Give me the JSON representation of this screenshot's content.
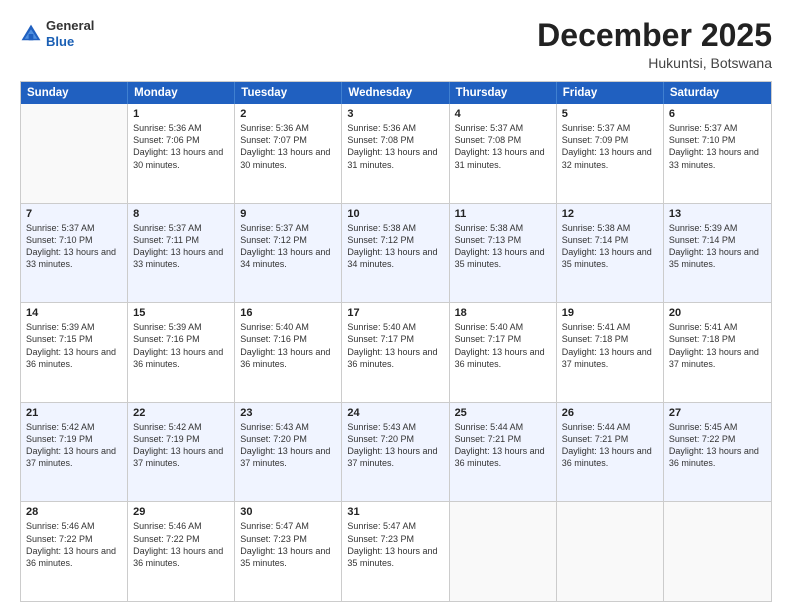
{
  "logo": {
    "general": "General",
    "blue": "Blue"
  },
  "header": {
    "month": "December 2025",
    "location": "Hukuntsi, Botswana"
  },
  "weekdays": [
    "Sunday",
    "Monday",
    "Tuesday",
    "Wednesday",
    "Thursday",
    "Friday",
    "Saturday"
  ],
  "weeks": [
    [
      {
        "day": "",
        "sunrise": "",
        "sunset": "",
        "daylight": ""
      },
      {
        "day": "1",
        "sunrise": "Sunrise: 5:36 AM",
        "sunset": "Sunset: 7:06 PM",
        "daylight": "Daylight: 13 hours and 30 minutes."
      },
      {
        "day": "2",
        "sunrise": "Sunrise: 5:36 AM",
        "sunset": "Sunset: 7:07 PM",
        "daylight": "Daylight: 13 hours and 30 minutes."
      },
      {
        "day": "3",
        "sunrise": "Sunrise: 5:36 AM",
        "sunset": "Sunset: 7:08 PM",
        "daylight": "Daylight: 13 hours and 31 minutes."
      },
      {
        "day": "4",
        "sunrise": "Sunrise: 5:37 AM",
        "sunset": "Sunset: 7:08 PM",
        "daylight": "Daylight: 13 hours and 31 minutes."
      },
      {
        "day": "5",
        "sunrise": "Sunrise: 5:37 AM",
        "sunset": "Sunset: 7:09 PM",
        "daylight": "Daylight: 13 hours and 32 minutes."
      },
      {
        "day": "6",
        "sunrise": "Sunrise: 5:37 AM",
        "sunset": "Sunset: 7:10 PM",
        "daylight": "Daylight: 13 hours and 33 minutes."
      }
    ],
    [
      {
        "day": "7",
        "sunrise": "Sunrise: 5:37 AM",
        "sunset": "Sunset: 7:10 PM",
        "daylight": "Daylight: 13 hours and 33 minutes."
      },
      {
        "day": "8",
        "sunrise": "Sunrise: 5:37 AM",
        "sunset": "Sunset: 7:11 PM",
        "daylight": "Daylight: 13 hours and 33 minutes."
      },
      {
        "day": "9",
        "sunrise": "Sunrise: 5:37 AM",
        "sunset": "Sunset: 7:12 PM",
        "daylight": "Daylight: 13 hours and 34 minutes."
      },
      {
        "day": "10",
        "sunrise": "Sunrise: 5:38 AM",
        "sunset": "Sunset: 7:12 PM",
        "daylight": "Daylight: 13 hours and 34 minutes."
      },
      {
        "day": "11",
        "sunrise": "Sunrise: 5:38 AM",
        "sunset": "Sunset: 7:13 PM",
        "daylight": "Daylight: 13 hours and 35 minutes."
      },
      {
        "day": "12",
        "sunrise": "Sunrise: 5:38 AM",
        "sunset": "Sunset: 7:14 PM",
        "daylight": "Daylight: 13 hours and 35 minutes."
      },
      {
        "day": "13",
        "sunrise": "Sunrise: 5:39 AM",
        "sunset": "Sunset: 7:14 PM",
        "daylight": "Daylight: 13 hours and 35 minutes."
      }
    ],
    [
      {
        "day": "14",
        "sunrise": "Sunrise: 5:39 AM",
        "sunset": "Sunset: 7:15 PM",
        "daylight": "Daylight: 13 hours and 36 minutes."
      },
      {
        "day": "15",
        "sunrise": "Sunrise: 5:39 AM",
        "sunset": "Sunset: 7:16 PM",
        "daylight": "Daylight: 13 hours and 36 minutes."
      },
      {
        "day": "16",
        "sunrise": "Sunrise: 5:40 AM",
        "sunset": "Sunset: 7:16 PM",
        "daylight": "Daylight: 13 hours and 36 minutes."
      },
      {
        "day": "17",
        "sunrise": "Sunrise: 5:40 AM",
        "sunset": "Sunset: 7:17 PM",
        "daylight": "Daylight: 13 hours and 36 minutes."
      },
      {
        "day": "18",
        "sunrise": "Sunrise: 5:40 AM",
        "sunset": "Sunset: 7:17 PM",
        "daylight": "Daylight: 13 hours and 36 minutes."
      },
      {
        "day": "19",
        "sunrise": "Sunrise: 5:41 AM",
        "sunset": "Sunset: 7:18 PM",
        "daylight": "Daylight: 13 hours and 37 minutes."
      },
      {
        "day": "20",
        "sunrise": "Sunrise: 5:41 AM",
        "sunset": "Sunset: 7:18 PM",
        "daylight": "Daylight: 13 hours and 37 minutes."
      }
    ],
    [
      {
        "day": "21",
        "sunrise": "Sunrise: 5:42 AM",
        "sunset": "Sunset: 7:19 PM",
        "daylight": "Daylight: 13 hours and 37 minutes."
      },
      {
        "day": "22",
        "sunrise": "Sunrise: 5:42 AM",
        "sunset": "Sunset: 7:19 PM",
        "daylight": "Daylight: 13 hours and 37 minutes."
      },
      {
        "day": "23",
        "sunrise": "Sunrise: 5:43 AM",
        "sunset": "Sunset: 7:20 PM",
        "daylight": "Daylight: 13 hours and 37 minutes."
      },
      {
        "day": "24",
        "sunrise": "Sunrise: 5:43 AM",
        "sunset": "Sunset: 7:20 PM",
        "daylight": "Daylight: 13 hours and 37 minutes."
      },
      {
        "day": "25",
        "sunrise": "Sunrise: 5:44 AM",
        "sunset": "Sunset: 7:21 PM",
        "daylight": "Daylight: 13 hours and 36 minutes."
      },
      {
        "day": "26",
        "sunrise": "Sunrise: 5:44 AM",
        "sunset": "Sunset: 7:21 PM",
        "daylight": "Daylight: 13 hours and 36 minutes."
      },
      {
        "day": "27",
        "sunrise": "Sunrise: 5:45 AM",
        "sunset": "Sunset: 7:22 PM",
        "daylight": "Daylight: 13 hours and 36 minutes."
      }
    ],
    [
      {
        "day": "28",
        "sunrise": "Sunrise: 5:46 AM",
        "sunset": "Sunset: 7:22 PM",
        "daylight": "Daylight: 13 hours and 36 minutes."
      },
      {
        "day": "29",
        "sunrise": "Sunrise: 5:46 AM",
        "sunset": "Sunset: 7:22 PM",
        "daylight": "Daylight: 13 hours and 36 minutes."
      },
      {
        "day": "30",
        "sunrise": "Sunrise: 5:47 AM",
        "sunset": "Sunset: 7:23 PM",
        "daylight": "Daylight: 13 hours and 35 minutes."
      },
      {
        "day": "31",
        "sunrise": "Sunrise: 5:47 AM",
        "sunset": "Sunset: 7:23 PM",
        "daylight": "Daylight: 13 hours and 35 minutes."
      },
      {
        "day": "",
        "sunrise": "",
        "sunset": "",
        "daylight": ""
      },
      {
        "day": "",
        "sunrise": "",
        "sunset": "",
        "daylight": ""
      },
      {
        "day": "",
        "sunrise": "",
        "sunset": "",
        "daylight": ""
      }
    ]
  ]
}
